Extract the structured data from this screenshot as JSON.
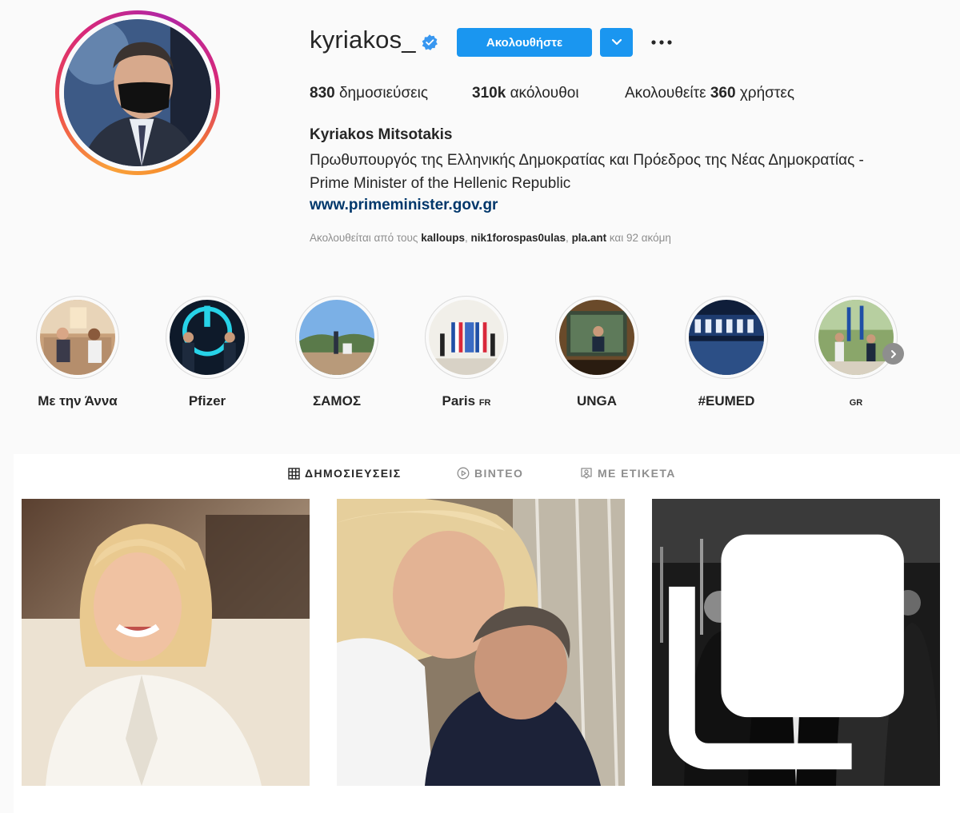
{
  "profile": {
    "username": "kyriakos_",
    "follow_label": "Ακολουθήστε",
    "full_name": "Kyriakos Mitsotakis",
    "bio_line1": "Πρωθυπουργός της Ελληνικής Δημοκρατίας και Πρόεδρος της Νέας Δημοκρατίας -",
    "bio_line2": "Prime Minister of the Hellenic Republic",
    "website": "www.primeminister.gov.gr",
    "verified_color": "#3897f0"
  },
  "stats": {
    "posts_value": "830",
    "posts_label": "δημοσιεύσεις",
    "followers_value": "310k",
    "followers_label": "ακόλουθοι",
    "following_prefix": "Ακολουθείτε",
    "following_value": "360",
    "following_suffix": "χρήστες"
  },
  "followed_by": {
    "prefix": "Ακολουθείται από τους",
    "users": [
      "kalloups",
      "nik1forospas0ulas",
      "pla.ant"
    ],
    "sep": ",",
    "suffix": "και 92 ακόμη"
  },
  "highlights": [
    {
      "label": "Με την Άννα",
      "flag": ""
    },
    {
      "label": "Pfizer",
      "flag": ""
    },
    {
      "label": "ΣΑΜΟΣ",
      "flag": ""
    },
    {
      "label": "Paris",
      "flag": "FR"
    },
    {
      "label": "UNGA",
      "flag": ""
    },
    {
      "label": "#EUMED",
      "flag": ""
    },
    {
      "label": "",
      "flag": "GR"
    }
  ],
  "tabs": [
    {
      "label": "ΔΗΜΟΣΙΕΥΣΕΙΣ",
      "icon": "grid-icon",
      "active": true
    },
    {
      "label": "ΒΙΝΤΕΟ",
      "icon": "play-icon",
      "active": false
    },
    {
      "label": "ΜΕ ΕΤΙΚΕΤΑ",
      "icon": "tagged-icon",
      "active": false
    }
  ],
  "colors": {
    "accent": "#1a96f0",
    "link": "#00376b",
    "muted": "#8e8e8e"
  }
}
